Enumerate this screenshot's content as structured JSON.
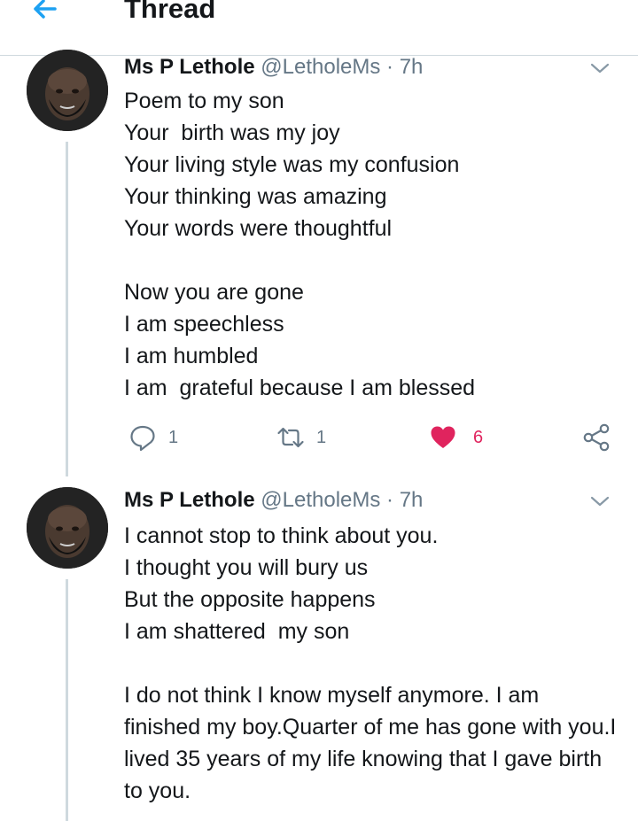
{
  "header": {
    "title": "Thread",
    "back_icon": "arrow-left-icon",
    "accent_color": "#1da1f2"
  },
  "tweets": [
    {
      "author": {
        "name": "Ms P Lethole",
        "handle": "@LetholeMs"
      },
      "separator": "·",
      "time": "7h",
      "stanzas": [
        [
          "Poem to my son",
          "Your  birth was my joy",
          "Your living style was my confusion",
          "Your thinking was amazing",
          "Your words were thoughtful"
        ],
        [
          "Now you are gone",
          "I am speechless",
          "I am humbled",
          "I am  grateful because I am blessed"
        ]
      ],
      "actions": {
        "reply_count": "1",
        "retweet_count": "1",
        "like_count": "6",
        "liked": true,
        "like_color": "#e0245e"
      }
    },
    {
      "author": {
        "name": "Ms P Lethole",
        "handle": "@LetholeMs"
      },
      "separator": "·",
      "time": "7h",
      "stanzas": [
        [
          "I cannot stop to think about you.",
          "I thought you will bury us",
          "But the opposite happens",
          "I am shattered  my son"
        ],
        [
          "I do not think I know myself anymore. I am finished my boy.Quarter of me has gone with you.I lived 35 years of my life knowing that I gave birth to you."
        ]
      ]
    }
  ]
}
